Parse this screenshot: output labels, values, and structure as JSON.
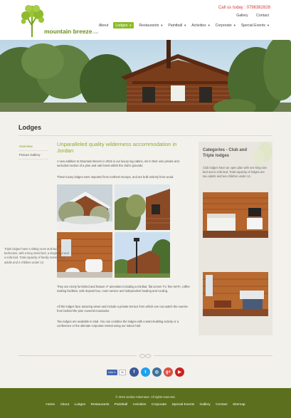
{
  "header": {
    "logo_text": "mountain breeze",
    "logo_tagline": "resort",
    "call_us": "Call us today : 0796382828",
    "top_links": [
      "Gallery",
      "Contact"
    ],
    "nav": [
      {
        "label": "About",
        "dropdown": false,
        "active": false
      },
      {
        "label": "Lodges",
        "dropdown": true,
        "active": true
      },
      {
        "label": "Restaurants",
        "dropdown": true,
        "active": false
      },
      {
        "label": "Paintball",
        "dropdown": true,
        "active": false
      },
      {
        "label": "Activities",
        "dropdown": true,
        "active": false
      },
      {
        "label": "Corporate",
        "dropdown": true,
        "active": false
      },
      {
        "label": "Special Events",
        "dropdown": true,
        "active": false
      }
    ]
  },
  "page": {
    "title": "Lodges",
    "subnav": [
      "Overview",
      "Picture Gallery"
    ]
  },
  "main": {
    "heading": "Unparalleled quality wilderness accommodation in Jordan",
    "paragraphs": [
      "A new addition to Mountain Breeze in 2015 is our luxury log cabins, set in their own private and secluded section of a pine and oak forest within the club's grounds.",
      "These luxury lodges were imported from northern Europe, and are built entirely from wood.",
      "They are nicely furnished and feature 4* amenities including a minibar, flat screen TV, free Wi-Fi, coffee making facilities, safe deposit box, room service and independent heating and cooling.",
      "All the lodges face amazing views and include a private terrace from which one can watch the sunrise from behind the pine covered mountains.",
      "Two lodges are available in total. You can combine the lodges with a team-building activity or a conference or the ultimate corporate retreat using our indoor hall."
    ]
  },
  "sidebar": {
    "title": "Categories - Club and Triple lodges",
    "p1": "Club lodges have an open plan with one king size bed and a sofa bed. Total capacity of lodges are two adults and two children under 12.",
    "p2": "Triple lodges have a sitting room and two bedrooms, with a king sized bed, a single bed and a sofa bed. Total capacity of family rooms are 3 adults and 2 children under 12."
  },
  "social": [
    {
      "icon": "like-icon",
      "label": "Like 1",
      "color": "#4267b2"
    },
    {
      "icon": "facebook-icon",
      "label": "f",
      "color": "#3b5998"
    },
    {
      "icon": "twitter-icon",
      "label": "t",
      "color": "#1da1f2"
    },
    {
      "icon": "instagram-icon",
      "label": "◎",
      "color": "#3f729b"
    },
    {
      "icon": "google-plus-icon",
      "label": "g+",
      "color": "#dc4e41"
    },
    {
      "icon": "youtube-icon",
      "label": "▶",
      "color": "#cd201f"
    }
  ],
  "footer": {
    "copyright": "© 2016 Jordan Adventure. All rights reserved.",
    "links": [
      "Home",
      "About",
      "Lodges",
      "Restaurants",
      "Paintball",
      "Activities",
      "Corporate",
      "Special Events",
      "Gallery",
      "Contact",
      "Sitemap"
    ]
  },
  "colors": {
    "accent": "#8dbb2c",
    "footer": "#5b6f1e",
    "call_us": "#d33c35"
  }
}
